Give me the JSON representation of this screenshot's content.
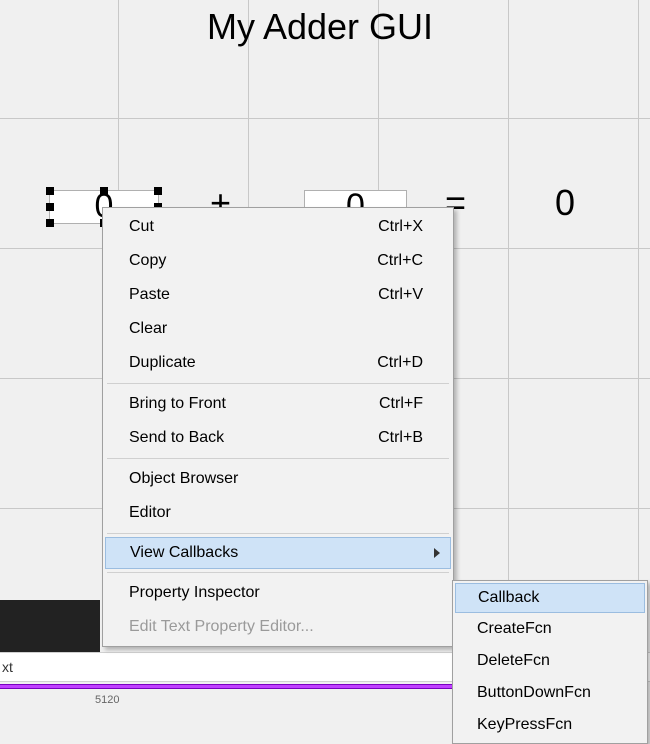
{
  "title": "My Adder GUI",
  "operands": {
    "field1": "0",
    "field2": "0",
    "plus": "+",
    "equals": "=",
    "result": "0"
  },
  "statusbar": {
    "text": "xt"
  },
  "ruler": {
    "tick": "5120"
  },
  "context_menu": {
    "items": [
      {
        "label": "Cut",
        "shortcut": "Ctrl+X"
      },
      {
        "label": "Copy",
        "shortcut": "Ctrl+C"
      },
      {
        "label": "Paste",
        "shortcut": "Ctrl+V"
      },
      {
        "label": "Clear",
        "shortcut": ""
      },
      {
        "label": "Duplicate",
        "shortcut": "Ctrl+D"
      },
      {
        "sep": true
      },
      {
        "label": "Bring to Front",
        "shortcut": "Ctrl+F"
      },
      {
        "label": "Send to Back",
        "shortcut": "Ctrl+B"
      },
      {
        "sep": true
      },
      {
        "label": "Object Browser",
        "shortcut": ""
      },
      {
        "label": "Editor",
        "shortcut": ""
      },
      {
        "sep": true
      },
      {
        "label": "View Callbacks",
        "shortcut": "",
        "submenu": true,
        "highlight": true
      },
      {
        "sep": true
      },
      {
        "label": "Property Inspector",
        "shortcut": ""
      },
      {
        "label": "Edit Text Property Editor...",
        "shortcut": "",
        "disabled": true
      }
    ]
  },
  "submenu": {
    "items": [
      {
        "label": "Callback",
        "highlight": true
      },
      {
        "label": "CreateFcn"
      },
      {
        "label": "DeleteFcn"
      },
      {
        "label": "ButtonDownFcn"
      },
      {
        "label": "KeyPressFcn"
      }
    ]
  }
}
